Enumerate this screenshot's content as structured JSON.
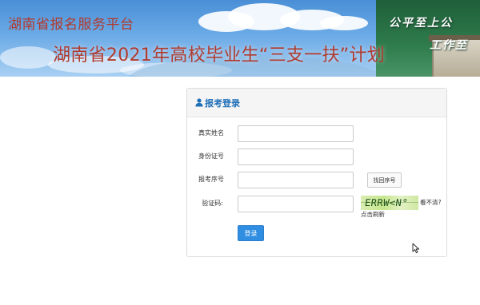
{
  "banner": {
    "brand_title": "湖南省报名服务平台",
    "plan_title": "湖南省2021年高校毕业生“三支一扶”计划",
    "slogan_line1": "公平至上公",
    "slogan_line2": "工作至"
  },
  "login": {
    "title": "报考登录",
    "icon": "user-icon",
    "fields": [
      {
        "label": "真实姓名",
        "value": "",
        "placeholder": ""
      },
      {
        "label": "身份证号",
        "value": "",
        "placeholder": ""
      },
      {
        "label": "报考序号",
        "value": "",
        "placeholder": ""
      },
      {
        "label": "验证码:",
        "value": "",
        "placeholder": ""
      }
    ],
    "find_serial_button": "找回序号",
    "captcha_text": "ERRW<N°",
    "unclear_link": "看不清?",
    "refresh_link": "点击刷新",
    "submit_button": "登录"
  },
  "colors": {
    "title_red": "#b13a2d",
    "header_blue": "#1f6fb8",
    "button_blue": "#2f8de2",
    "captcha_green": "#c7e78f"
  }
}
